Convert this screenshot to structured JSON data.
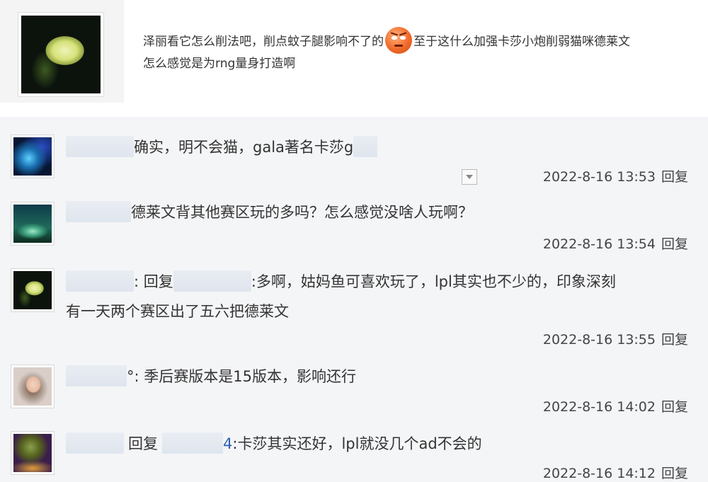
{
  "post": {
    "avatar_icon": "chrysanthemum-avatar",
    "text_before_emoticon": "泽丽看它怎么削法吧，削点蚊子腿影响不了的",
    "emoticon_icon": "angry-face-emoticon",
    "text_after_emoticon": "至于这什么加强卡莎小炮削弱猫咪德莱文",
    "text_line2": "怎么感觉是为rng量身打造啊"
  },
  "replies": [
    {
      "avatar_icon": "blue-fantasy-avatar",
      "content": "确实，明不会猫，gala著名卡莎g",
      "timestamp": "2022-8-16 13:53",
      "reply_label": "回复",
      "has_dropdown": true
    },
    {
      "avatar_icon": "green-fantasy-avatar",
      "content": "德莱文背其他赛区玩的多吗？怎么感觉没啥人玩啊？",
      "timestamp": "2022-8-16 13:54",
      "reply_label": "回复"
    },
    {
      "avatar_icon": "chrysanthemum-avatar",
      "prefix": ": 回复",
      "content": ":多啊，姑妈鱼可喜欢玩了，lpl其实也不少的，印象深刻",
      "content_line2": "有一天两个赛区出了五六把德莱文",
      "timestamp": "2022-8-16 13:55",
      "reply_label": "回复"
    },
    {
      "avatar_icon": "woman-portrait-avatar",
      "username_tail": "°",
      "content": ": 季后赛版本是15版本，影响还行",
      "timestamp": "2022-8-16 14:02",
      "reply_label": "回复"
    },
    {
      "avatar_icon": "dusk-landscape-avatar",
      "prefix": "回复",
      "username_tail": "4",
      "content": ":卡莎其实还好，lpl就没几个ad不会的",
      "timestamp": "2022-8-16 14:12",
      "reply_label": "回复"
    }
  ]
}
